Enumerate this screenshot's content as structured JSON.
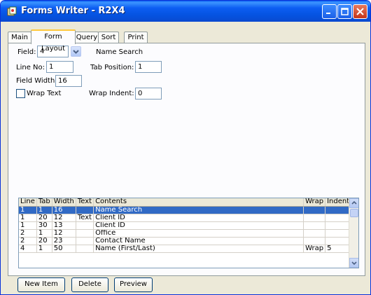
{
  "window": {
    "title": "Forms Writer - R2X4"
  },
  "tabs": [
    {
      "label": "Main"
    },
    {
      "label": "Form Layout"
    },
    {
      "label": "Query"
    },
    {
      "label": "Sort"
    },
    {
      "label": "Print"
    }
  ],
  "form": {
    "field_label": "Field:",
    "field_value": "4",
    "field_name": "Name Search",
    "line_no_label": "Line No:",
    "line_no_value": "1",
    "tab_position_label": "Tab Position:",
    "tab_position_value": "1",
    "field_width_label": "Field Width:",
    "field_width_value": "16",
    "wrap_text_label": "Wrap Text",
    "wrap_text_checked": false,
    "wrap_indent_label": "Wrap Indent:",
    "wrap_indent_value": "0"
  },
  "grid": {
    "columns": [
      "Line",
      "Tab",
      "Width",
      "Text",
      "Contents",
      "Wrap",
      "Indent"
    ],
    "rows": [
      {
        "line": "1",
        "tab": "1",
        "width": "16",
        "text": "",
        "contents": "Name Search",
        "wrap": "",
        "indent": "",
        "selected": true
      },
      {
        "line": "1",
        "tab": "20",
        "width": "12",
        "text": "Text",
        "contents": "Client ID",
        "wrap": "",
        "indent": ""
      },
      {
        "line": "1",
        "tab": "30",
        "width": "13",
        "text": "",
        "contents": "Client ID",
        "wrap": "",
        "indent": ""
      },
      {
        "line": "2",
        "tab": "1",
        "width": "12",
        "text": "",
        "contents": "Office",
        "wrap": "",
        "indent": ""
      },
      {
        "line": "2",
        "tab": "20",
        "width": "23",
        "text": "",
        "contents": "Contact Name",
        "wrap": "",
        "indent": ""
      },
      {
        "line": "4",
        "tab": "1",
        "width": "50",
        "text": "",
        "contents": "Name (First/Last)",
        "wrap": "Wrap",
        "indent": "5"
      }
    ]
  },
  "buttons": {
    "new_item": "New Item",
    "delete": "Delete",
    "preview": "Preview"
  },
  "colors": {
    "titlebar": "#0a5ff0",
    "selection": "#316ac5",
    "active_tab_accent": "#ffc83c"
  }
}
